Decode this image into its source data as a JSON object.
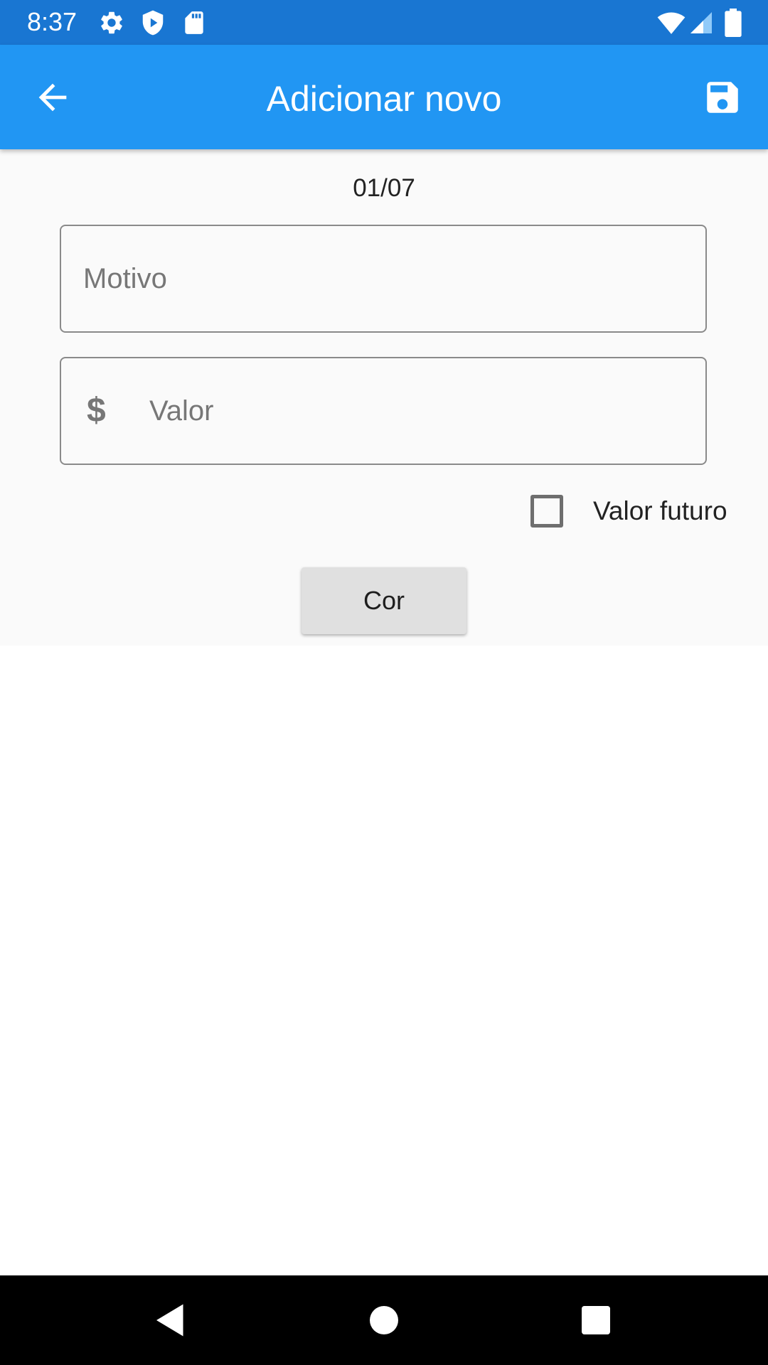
{
  "status_bar": {
    "time": "8:37",
    "icons": [
      "settings-icon",
      "play-protect-icon",
      "sd-card-icon",
      "wifi-icon",
      "signal-icon",
      "battery-icon"
    ]
  },
  "app_bar": {
    "title": "Adicionar novo",
    "back_icon": "arrow-back-icon",
    "save_icon": "save-icon",
    "background": "#2196F3"
  },
  "form": {
    "date": "01/07",
    "motivo": {
      "placeholder": "Motivo",
      "value": ""
    },
    "valor": {
      "placeholder": "Valor",
      "value": "",
      "prefix_icon": "dollar-icon"
    },
    "valor_futuro": {
      "label": "Valor futuro",
      "checked": false
    },
    "cor_button": {
      "label": "Cor"
    }
  },
  "nav_bar": {
    "icons": [
      "back-triangle-icon",
      "home-circle-icon",
      "recents-square-icon"
    ]
  }
}
